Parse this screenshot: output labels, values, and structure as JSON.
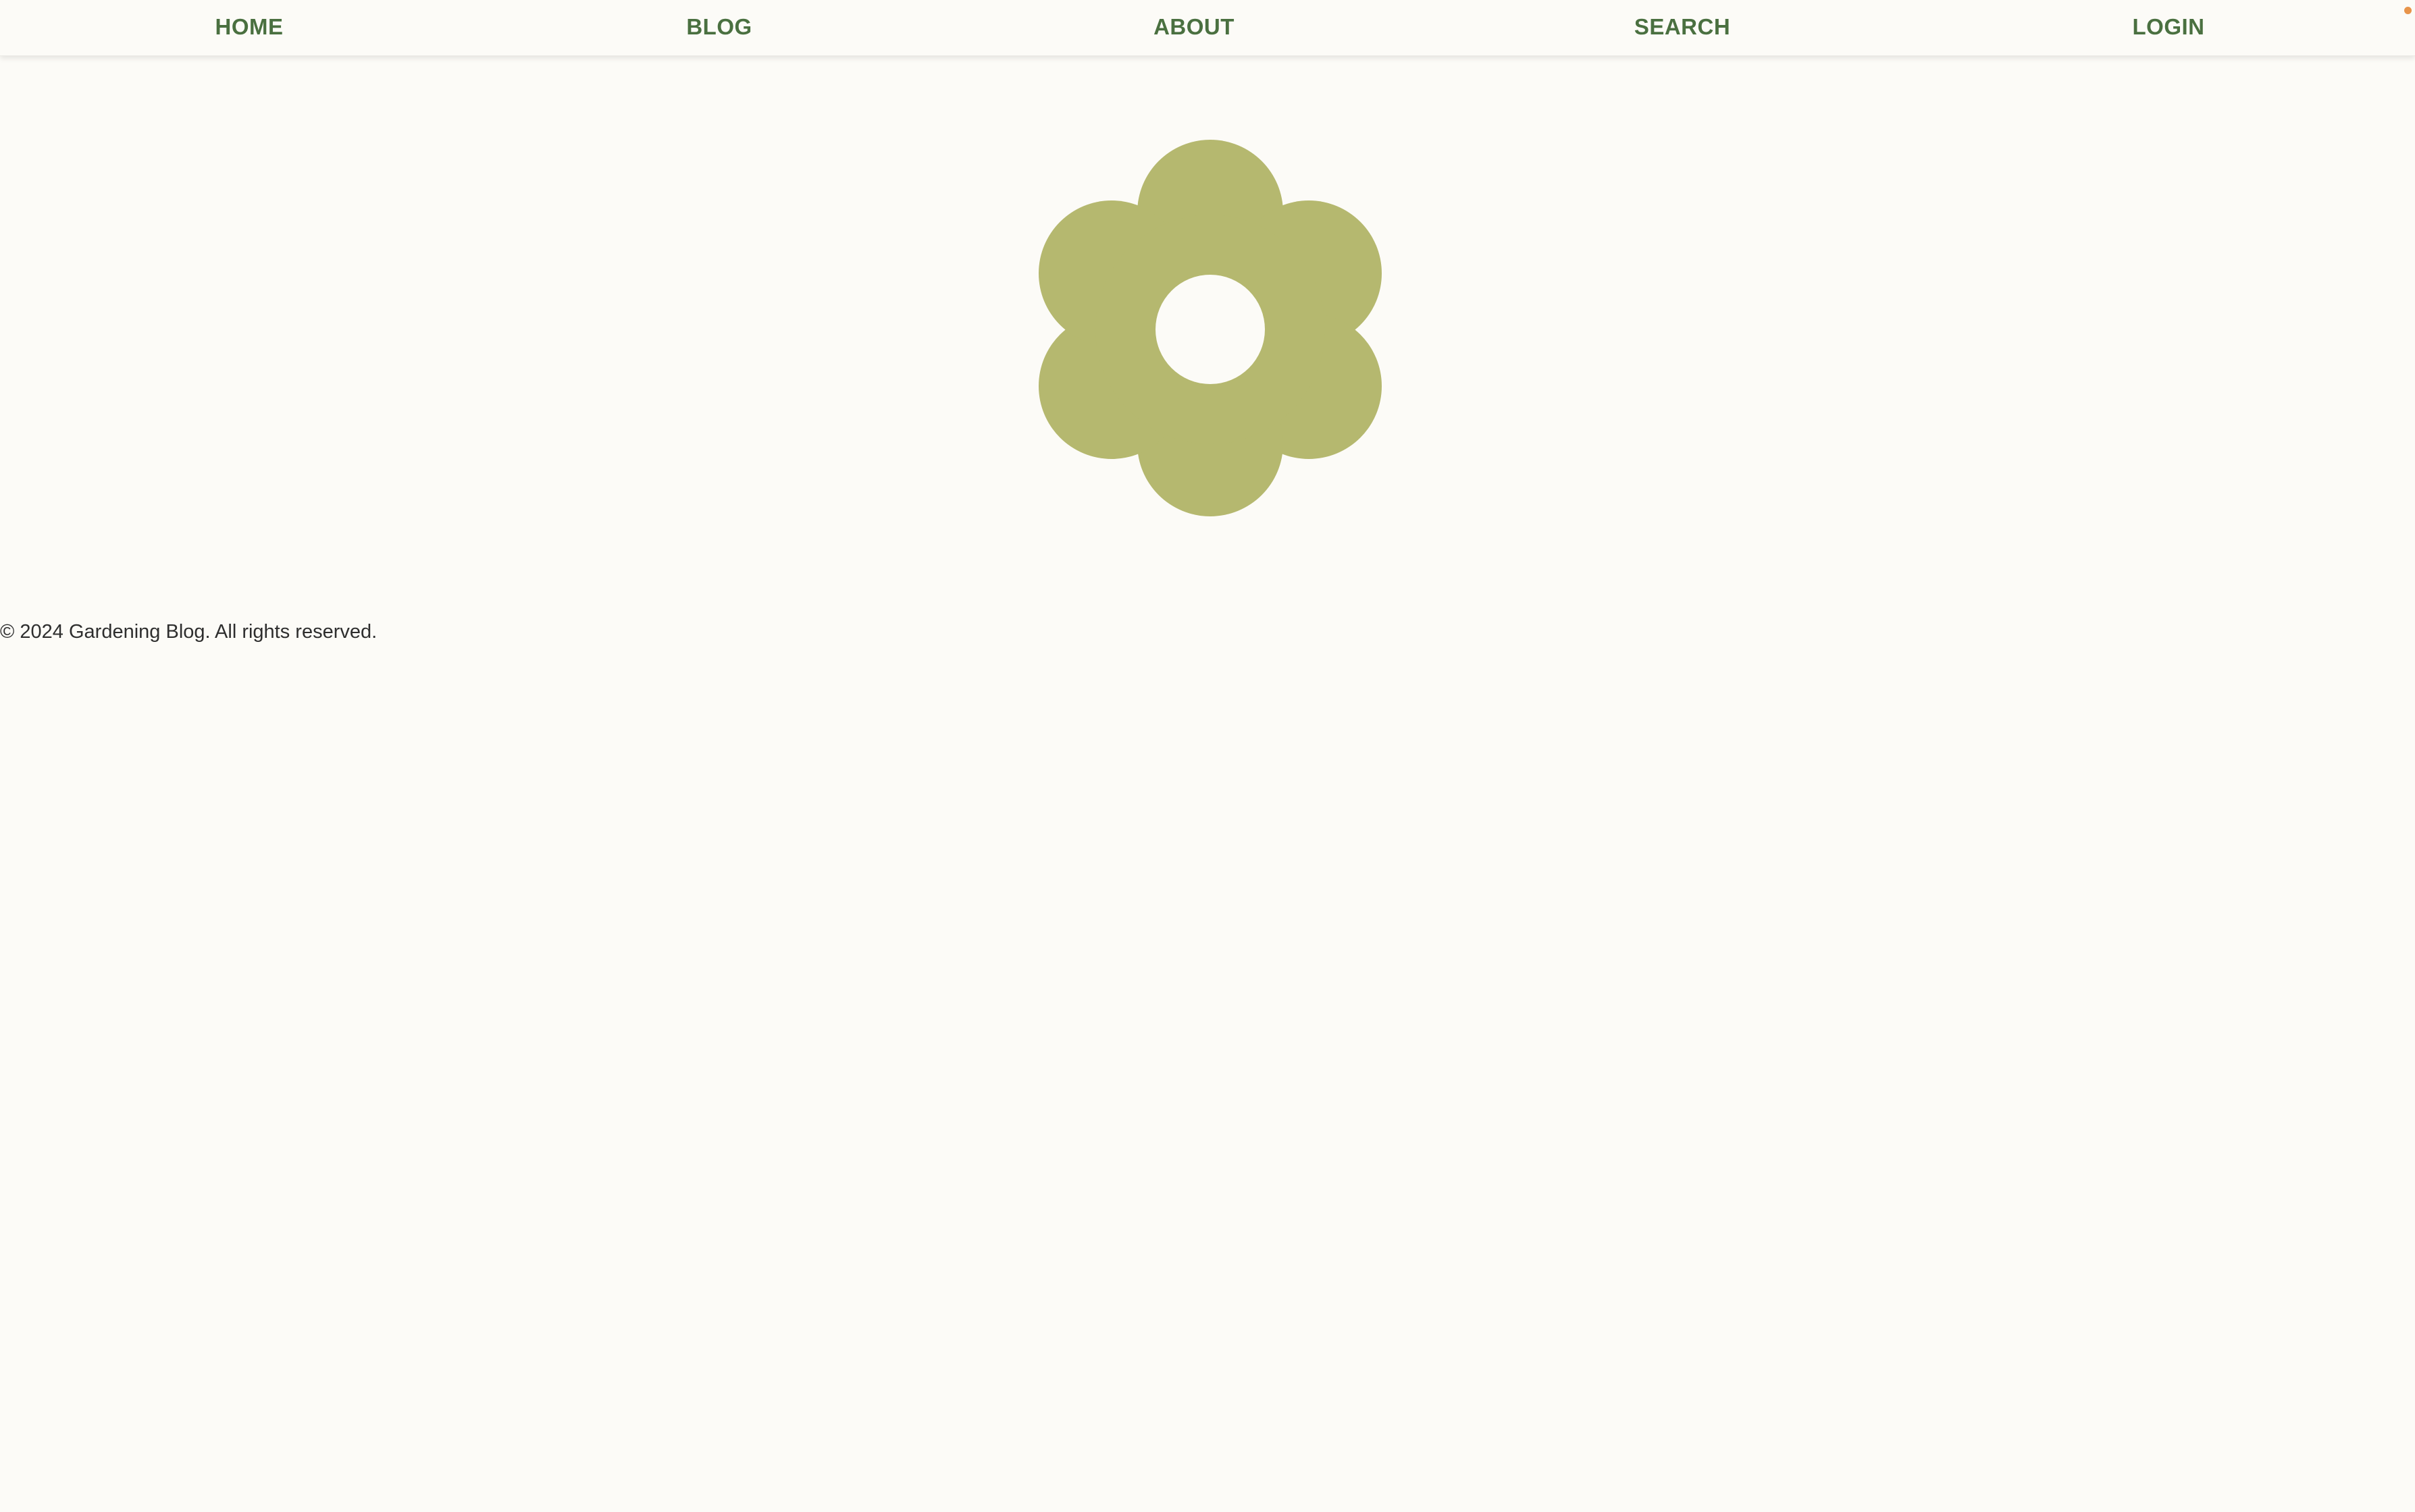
{
  "nav": {
    "items": [
      {
        "label": "HOME"
      },
      {
        "label": "BLOG"
      },
      {
        "label": "ABOUT"
      },
      {
        "label": "SEARCH"
      },
      {
        "label": "LOGIN"
      }
    ]
  },
  "logo": {
    "icon": "flower-icon",
    "color": "#b5b86f"
  },
  "notification": {
    "color": "#e8944a"
  },
  "footer": {
    "copyright": "© 2024 Gardening Blog. All rights reserved."
  }
}
